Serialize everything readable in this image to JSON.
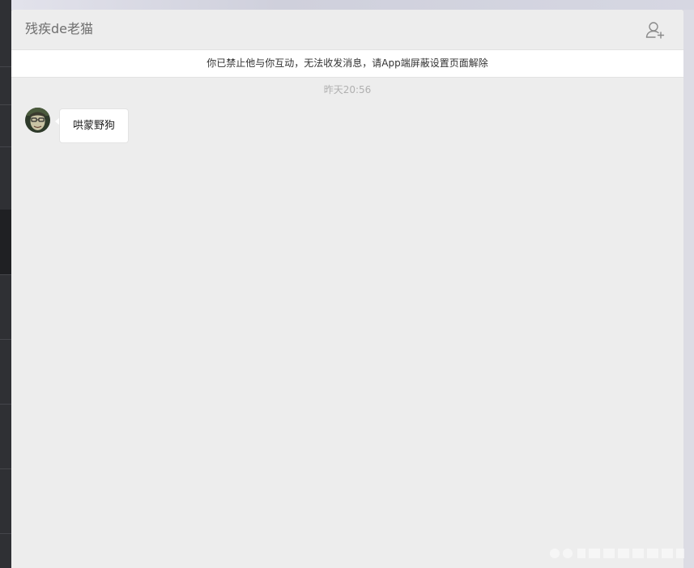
{
  "chat": {
    "title": "残疾de老猫",
    "add_member_icon": "add-user-icon",
    "notice": "你已禁止他与你互动，无法收发消息，请App端屏蔽设置页面解除",
    "timestamp": "昨天20:56",
    "messages": [
      {
        "sender": "other",
        "avatar_icon": "avatar",
        "text": "哄蒙野狗"
      }
    ]
  },
  "colors": {
    "window_bg": "#ededed",
    "notice_bg": "#ffffff",
    "bubble_bg": "#ffffff",
    "sidebar_bg": "#2f3034",
    "title_text": "#6f6f6f",
    "timestamp_text": "#b0b0b0"
  }
}
